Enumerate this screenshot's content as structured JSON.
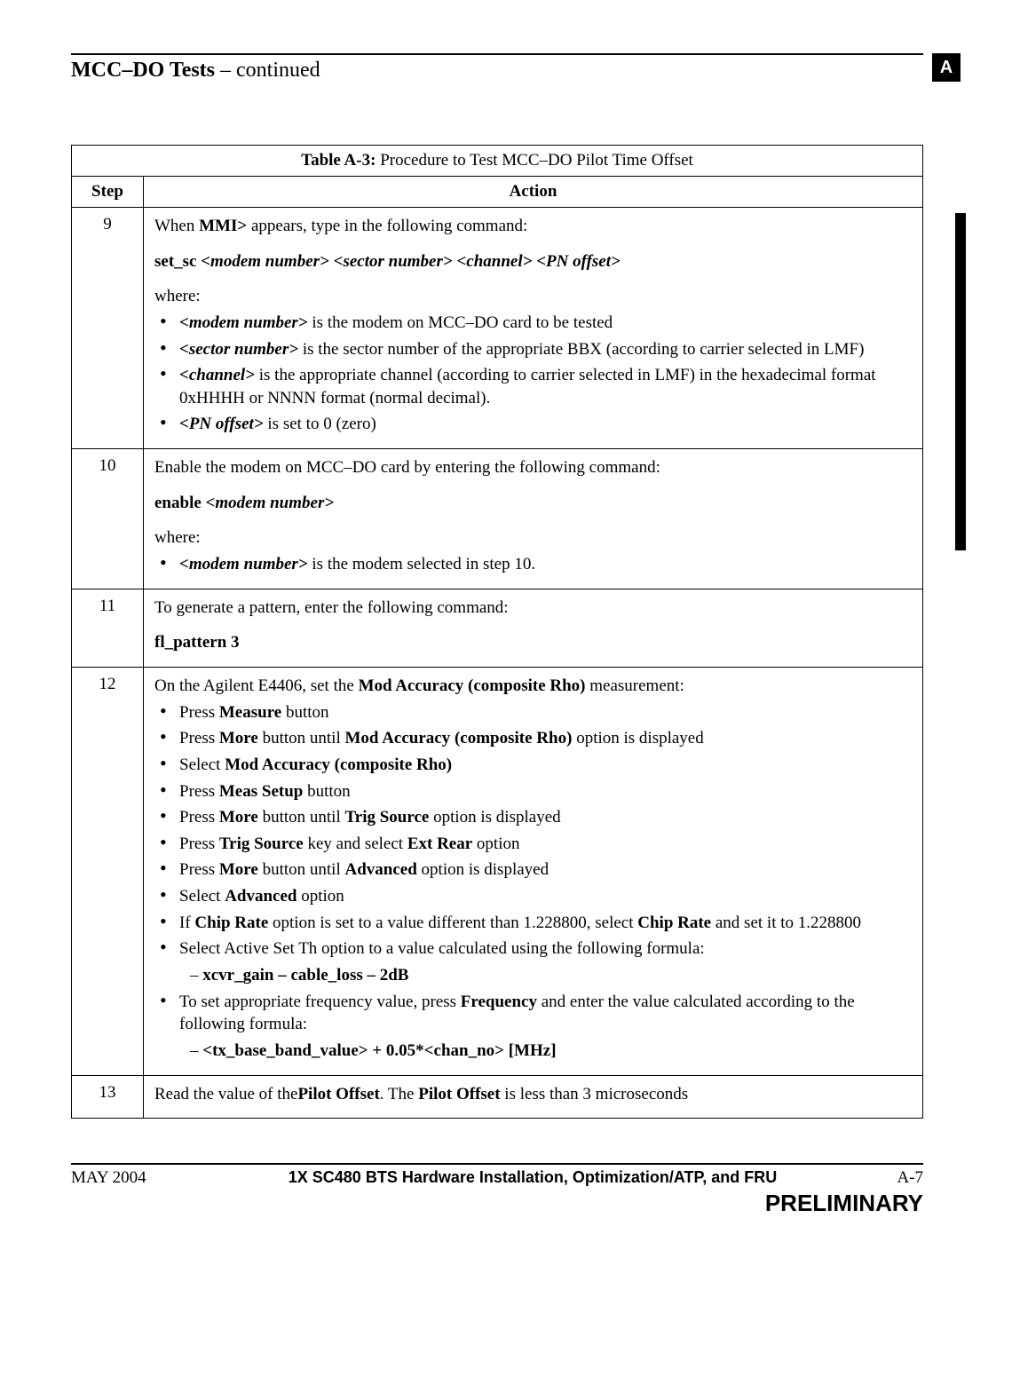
{
  "header": {
    "title_bold": "MCC–DO Tests",
    "title_rest": " – continued",
    "tab": "A"
  },
  "table": {
    "title_bold": "Table A-3:",
    "title_rest": " Procedure to Test MCC–DO Pilot Time Offset",
    "col_step": "Step",
    "col_action": "Action"
  },
  "rows": {
    "r9": {
      "step": "9",
      "l1a": "When ",
      "l1b": "MMI>",
      "l1c": " appears, type in the following command:",
      "cmd": "set_sc <modem number> <sector number> <channel> <PN offset>",
      "where": "where:",
      "b1a": "<modem number>",
      "b1b": " is the modem on MCC–DO card to be tested",
      "b2a": "<sector number>",
      "b2b": " is the sector number of the appropriate BBX (according to carrier selected in LMF)",
      "b3a": "<channel>",
      "b3b": " is the appropriate channel (according to carrier selected in LMF) in the hexadecimal format 0xHHHH or NNNN format (normal decimal).",
      "b4a": "<PN offset>",
      "b4b": " is set to 0 (zero)"
    },
    "r10": {
      "step": "10",
      "l1": "Enable the modem on MCC–DO card by entering the following command:",
      "cmd_a": "enable ",
      "cmd_b": "<modem number>",
      "where": "where:",
      "b1a": "<modem number>",
      "b1b": " is the modem selected in step 10."
    },
    "r11": {
      "step": "11",
      "l1": "To generate a pattern, enter the following command:",
      "cmd": "fl_pattern 3"
    },
    "r12": {
      "step": "12",
      "l1a": "On the Agilent E4406, set the ",
      "l1b": "Mod Accuracy (composite Rho)",
      "l1c": " measurement:",
      "b1a": "Press ",
      "b1b": "Measure",
      "b1c": " button",
      "b2a": "Press ",
      "b2b": "More",
      "b2c": " button until ",
      "b2d": "Mod Accuracy (composite Rho)",
      "b2e": " option is displayed",
      "b3a": "Select ",
      "b3b": "Mod Accuracy (composite Rho)",
      "b4a": "Press ",
      "b4b": "Meas Setup",
      "b4c": " button",
      "b5a": "Press ",
      "b5b": "More",
      "b5c": " button until ",
      "b5d": "Trig Source",
      "b5e": " option is displayed",
      "b6a": "Press ",
      "b6b": "Trig Source",
      "b6c": " key and select ",
      "b6d": "Ext Rear",
      "b6e": " option",
      "b7a": "Press ",
      "b7b": "More",
      "b7c": " button until ",
      "b7d": "Advanced",
      "b7e": " option is displayed",
      "b8a": "Select ",
      "b8b": "Advanced",
      "b8c": " option",
      "b9a": "If ",
      "b9b": "Chip Rate",
      "b9c": " option is set to a value different than 1.228800, select ",
      "b9d": "Chip Rate",
      "b9e": " and set it to 1.228800",
      "b10": "Select Active Set Th option to a value calculated using the following formula:",
      "s1": "xcvr_gain – cable_loss – 2dB",
      "b11a": "To set appropriate frequency value,  press ",
      "b11b": "Frequency",
      "b11c": " and enter the value calculated according to the following formula:",
      "s2": "<tx_base_band_value> + 0.05*<chan_no> [MHz]"
    },
    "r13": {
      "step": "13",
      "l1a": "Read the value of the",
      "l1b": "Pilot Offset",
      "l1c": ". The ",
      "l1d": "Pilot Offset",
      "l1e": " is less than 3 microseconds"
    }
  },
  "footer": {
    "left": "MAY 2004",
    "center": "1X SC480 BTS Hardware Installation, Optimization/ATP, and FRU",
    "right": "A-7",
    "prelim": "PRELIMINARY"
  }
}
